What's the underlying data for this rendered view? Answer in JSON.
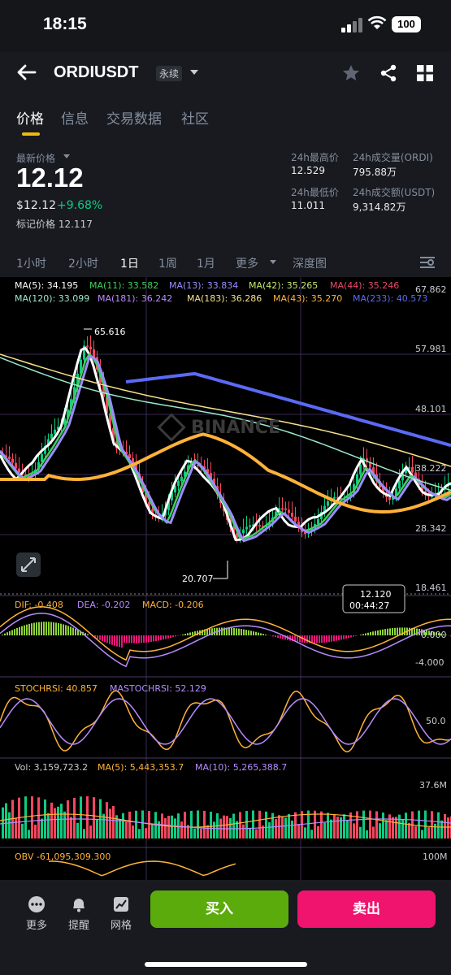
{
  "status": {
    "time": "18:15",
    "battery": "100"
  },
  "header": {
    "symbol": "ORDIUSDT",
    "type_label": "永续"
  },
  "tabs": [
    "价格",
    "信息",
    "交易数据",
    "社区"
  ],
  "price": {
    "latest_label": "最新价格",
    "last": "12.12",
    "usd": "$12.12",
    "change": "+9.68%",
    "mark_label": "标记价格",
    "mark": "12.117",
    "high_label": "24h最高价",
    "high": "12.529",
    "low_label": "24h最低价",
    "low": "11.011",
    "vol_label": "24h成交量(ORDI)",
    "vol": "795.88万",
    "amt_label": "24h成交额(USDT)",
    "amt": "9,314.82万"
  },
  "timeframes": [
    "1小时",
    "2小时",
    "1日",
    "1周",
    "1月",
    "更多",
    "深度图"
  ],
  "active_timeframe": "1日",
  "ma_legend": [
    {
      "text": "MA(5): 34.195",
      "color": "#ffffff"
    },
    {
      "text": "MA(11): 33.582",
      "color": "#3ecf5a"
    },
    {
      "text": "MA(13): 33.834",
      "color": "#9b8cff"
    },
    {
      "text": "MA(42): 35.265",
      "color": "#c6e86b"
    },
    {
      "text": "MA(44): 35.246",
      "color": "#e84a6a"
    },
    {
      "text": "MA(120): 33.099",
      "color": "#9ae8c8"
    },
    {
      "text": "MA(181): 36.242",
      "color": "#b68cff"
    },
    {
      "text": "MA(183): 36.286",
      "color": "#f6e18a"
    },
    {
      "text": "MA(43): 35.270",
      "color": "#ffb238"
    },
    {
      "text": "MA(233): 40.573",
      "color": "#5b6af5"
    }
  ],
  "axis_labels": [
    "67.862",
    "57.981",
    "48.101",
    "38.222",
    "28.342",
    "18.461"
  ],
  "annotations": {
    "high": "65.616",
    "low": "20.707",
    "tooltip_price": "12.120",
    "tooltip_time": "00:44:27"
  },
  "watermark": "BINANCE",
  "macd": {
    "dif": "DIF: -0.408",
    "dea": "DEA: -0.202",
    "macd": "MACD: -0.206",
    "axis": [
      "0.000",
      "-4.000"
    ]
  },
  "stoch": {
    "k": "STOCHRSI: 40.857",
    "d": "MASTOCHRSI: 52.129",
    "axis": "50.0"
  },
  "volume": {
    "vol": "Vol: 3,159,723.2",
    "ma5": "MA(5): 5,443,353.7",
    "ma10": "MA(10): 5,265,388.7",
    "axis": "37.6M"
  },
  "obv": {
    "label": "OBV -61,095,309.300",
    "axis": "100M"
  },
  "bottom": {
    "more": "更多",
    "alert": "提醒",
    "grid": "网格",
    "buy": "买入",
    "sell": "卖出"
  },
  "colors": {
    "up": "#0ecb81",
    "down": "#f6465d",
    "buy": "#5cab0c",
    "sell": "#f0146e",
    "accent": "#f0b90b"
  }
}
